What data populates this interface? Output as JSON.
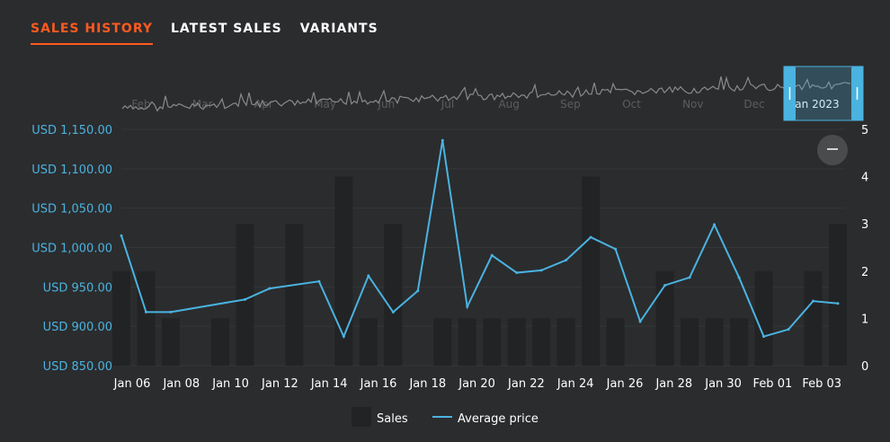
{
  "tabs": [
    "SALES HISTORY",
    "LATEST SALES",
    "VARIANTS"
  ],
  "colors": {
    "accent": "#ff5a1f",
    "price_line": "#4ab3e0",
    "bars": "#222324",
    "nav_line": "#8a8a8a",
    "background": "#2b2c2e"
  },
  "navigator": {
    "month_labels": [
      "Feb",
      "Mar",
      "Apr",
      "May",
      "Jun",
      "Jul",
      "Aug",
      "Sep",
      "Oct",
      "Nov",
      "Dec",
      "Jan 2023"
    ],
    "zoom_icon": "minus-icon"
  },
  "chart_data": {
    "type": "bar",
    "x_tick_labels": [
      "Jan 06",
      "Jan 08",
      "Jan 10",
      "Jan 12",
      "Jan 14",
      "Jan 16",
      "Jan 18",
      "Jan 20",
      "Jan 22",
      "Jan 24",
      "Jan 26",
      "Jan 28",
      "Jan 30",
      "Feb 01",
      "Feb 03"
    ],
    "left_axis": {
      "ticks": [
        "USD 850.00",
        "USD 900.00",
        "USD 950.00",
        "USD 1,000.00",
        "USD 1,050.00",
        "USD 1,100.00",
        "USD 1,150.00"
      ],
      "ylim": [
        850,
        1150
      ]
    },
    "right_axis": {
      "ticks": [
        "0",
        "1",
        "2",
        "3",
        "4",
        "5"
      ],
      "ylim": [
        0,
        5
      ]
    },
    "x_range": [
      "2023-01-05",
      "2023-02-03"
    ],
    "series": [
      {
        "name": "Sales",
        "type": "bar",
        "x": [
          "2023-01-05",
          "2023-01-06",
          "2023-01-07",
          "2023-01-09",
          "2023-01-10",
          "2023-01-12",
          "2023-01-14",
          "2023-01-15",
          "2023-01-16",
          "2023-01-18",
          "2023-01-19",
          "2023-01-20",
          "2023-01-21",
          "2023-01-22",
          "2023-01-23",
          "2023-01-24",
          "2023-01-25",
          "2023-01-27",
          "2023-01-28",
          "2023-01-29",
          "2023-01-30",
          "2023-01-31",
          "2023-02-02",
          "2023-02-03"
        ],
        "values": [
          2,
          2,
          1,
          1,
          3,
          3,
          4,
          1,
          3,
          1,
          1,
          1,
          1,
          1,
          1,
          4,
          1,
          2,
          1,
          1,
          1,
          2,
          2,
          3
        ]
      },
      {
        "name": "Average price",
        "type": "line",
        "x": [
          "2023-01-05",
          "2023-01-06",
          "2023-01-07",
          "2023-01-10",
          "2023-01-11",
          "2023-01-13",
          "2023-01-14",
          "2023-01-15",
          "2023-01-16",
          "2023-01-17",
          "2023-01-18",
          "2023-01-19",
          "2023-01-20",
          "2023-01-21",
          "2023-01-22",
          "2023-01-23",
          "2023-01-24",
          "2023-01-25",
          "2023-01-26",
          "2023-01-27",
          "2023-01-28",
          "2023-01-29",
          "2023-01-30",
          "2023-01-31",
          "2023-02-01",
          "2023-02-02",
          "2023-02-03"
        ],
        "values": [
          1015,
          918,
          918,
          934,
          948,
          957,
          887,
          964,
          918,
          945,
          1136,
          925,
          990,
          968,
          971,
          984,
          1013,
          998,
          906,
          952,
          962,
          1029,
          962,
          887,
          896,
          932,
          929
        ]
      }
    ],
    "legend": {
      "position": "bottom-center",
      "items": [
        "Sales",
        "Average price"
      ]
    },
    "grid": "horizontal"
  }
}
